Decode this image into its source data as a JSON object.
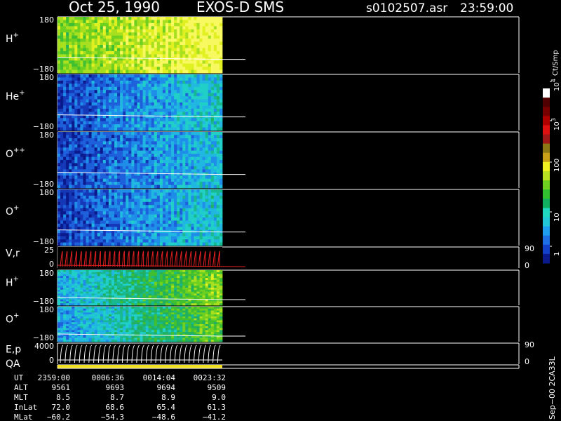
{
  "header": {
    "date": "Oct 25, 1990",
    "instrument": "EXOS-D SMS",
    "file": "s0102507.asr",
    "time": "23:59:00"
  },
  "colorbar": {
    "unit": "Ct/Smp",
    "tick_labels": [
      "1",
      "10",
      "100",
      "10",
      "10"
    ],
    "tick_exponents": [
      "",
      "",
      "",
      "3",
      "4"
    ],
    "colors": [
      "#0a1a8c",
      "#1240c8",
      "#1e6ee6",
      "#1e9ef0",
      "#20c8d8",
      "#20d8c0",
      "#10b060",
      "#30c030",
      "#70d020",
      "#b8e020",
      "#f0f020",
      "#c8a018",
      "#8c7814",
      "#a01818",
      "#e01010",
      "#b00000",
      "#780000",
      "#500000",
      "#ffffff"
    ]
  },
  "panels": [
    {
      "id": "hplus-1",
      "label": "H",
      "sup": "+",
      "ymax": "180",
      "ymin": "−180"
    },
    {
      "id": "heplus",
      "label": "He",
      "sup": "+",
      "ymax": "180",
      "ymin": "−180"
    },
    {
      "id": "oplusplus",
      "label": "O",
      "sup": "++",
      "ymax": "180",
      "ymin": "−180"
    },
    {
      "id": "oplus-1",
      "label": "O",
      "sup": "+",
      "ymax": "180",
      "ymin": "−180"
    },
    {
      "id": "vr",
      "label": "V,r",
      "sup": "",
      "ymax": "25",
      "ymin": "0",
      "right_top": "90",
      "right_bottom": "0"
    },
    {
      "id": "hplus-2",
      "label": "H",
      "sup": "+",
      "ymax": "180",
      "ymin": "−180"
    },
    {
      "id": "oplus-2",
      "label": "O",
      "sup": "+",
      "ymax": "180",
      "ymin": "−180"
    },
    {
      "id": "ep",
      "label": "E,p",
      "sup": "",
      "ymax": "4000",
      "ymin": "0",
      "right_top": "90",
      "right_bottom": "0"
    },
    {
      "id": "qa",
      "label": "QA",
      "sup": "",
      "ymax": "",
      "ymin": ""
    }
  ],
  "footer": {
    "rows": [
      {
        "label": "UT",
        "values": [
          "2359:00",
          "0006:36",
          "0014:04",
          "0023:32"
        ]
      },
      {
        "label": "ALT",
        "values": [
          "9561",
          "9693",
          "9694",
          "9509"
        ]
      },
      {
        "label": "MLT",
        "values": [
          "8.5",
          "8.7",
          "8.9",
          "9.0"
        ]
      },
      {
        "label": "InLat",
        "values": [
          "72.0",
          "68.6",
          "65.4",
          "61.3"
        ]
      },
      {
        "label": "MLat",
        "values": [
          "−60.2",
          "−54.3",
          "−48.6",
          "−41.2"
        ]
      }
    ],
    "side_label": "Sep−00 2CA33L"
  },
  "chart_data": {
    "type": "heatmap",
    "title": "Oct 25, 1990   EXOS-D SMS",
    "x_tick_labels_UT": [
      "2359:00",
      "0006:36",
      "0014:04",
      "0023:32"
    ],
    "series": [
      {
        "name": "H+",
        "yrange": [
          -180,
          180
        ],
        "data_extent_UT": [
          "2359:00",
          "0023:32"
        ],
        "intensity": "high (green-yellow), rising with time"
      },
      {
        "name": "He+",
        "yrange": [
          -180,
          180
        ],
        "intensity": "low (blue), increasing toward later times"
      },
      {
        "name": "O++",
        "yrange": [
          -180,
          180
        ],
        "intensity": "low (blue)"
      },
      {
        "name": "O+",
        "yrange": [
          -180,
          180
        ],
        "intensity": "low (blue)"
      },
      {
        "name": "V,r",
        "yrange": [
          0,
          25
        ],
        "right_axis": [
          0,
          90
        ]
      },
      {
        "name": "H+",
        "yrange": [
          -180,
          180
        ],
        "intensity": "medium-high (cyan-green)"
      },
      {
        "name": "O+",
        "yrange": [
          -180,
          180
        ],
        "intensity": "medium (cyan-green)"
      },
      {
        "name": "E,p",
        "yrange": [
          0,
          4000
        ],
        "right_axis": [
          0,
          90
        ]
      },
      {
        "name": "QA"
      }
    ],
    "colorbar": {
      "label": "Ct/Smp",
      "scale": "log",
      "range": [
        1,
        10000
      ]
    }
  }
}
